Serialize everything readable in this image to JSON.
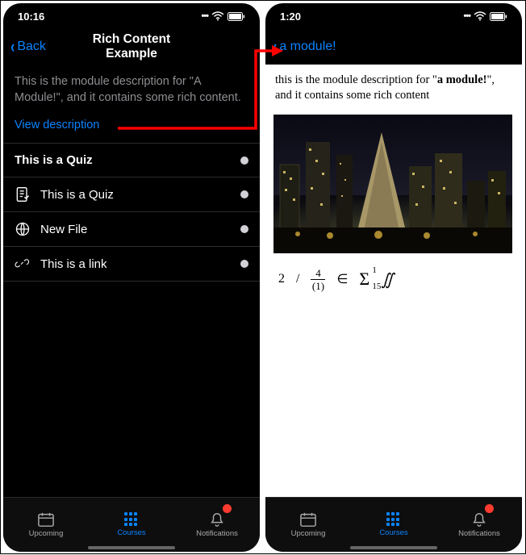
{
  "left": {
    "statusbar": {
      "time": "10:16"
    },
    "navbar": {
      "back": "Back",
      "title": "Rich Content Example"
    },
    "description": "This is the module description for \"A Module!\", and it contains some rich content.",
    "view_desc_label": "View description",
    "section_header": "This is a Quiz",
    "rows": [
      {
        "label": "This is a Quiz"
      },
      {
        "label": "New File"
      },
      {
        "label": "This is a link"
      }
    ]
  },
  "right": {
    "statusbar": {
      "time": "1:20"
    },
    "navbar": {
      "back": "a module!"
    },
    "body_prefix": "this is the module description for \"",
    "body_bold": "a module!",
    "body_suffix": "\", and it contains some rich content",
    "math": {
      "term1_base": "2",
      "term1_num": "4",
      "term1_den": "(1)",
      "slash": "/",
      "epsilon": "∈",
      "sigma_sup": "1",
      "sigma_sub": "15",
      "integral": "∬"
    }
  },
  "tabs": {
    "upcoming": "Upcoming",
    "courses": "Courses",
    "notifications": "Notifications"
  }
}
